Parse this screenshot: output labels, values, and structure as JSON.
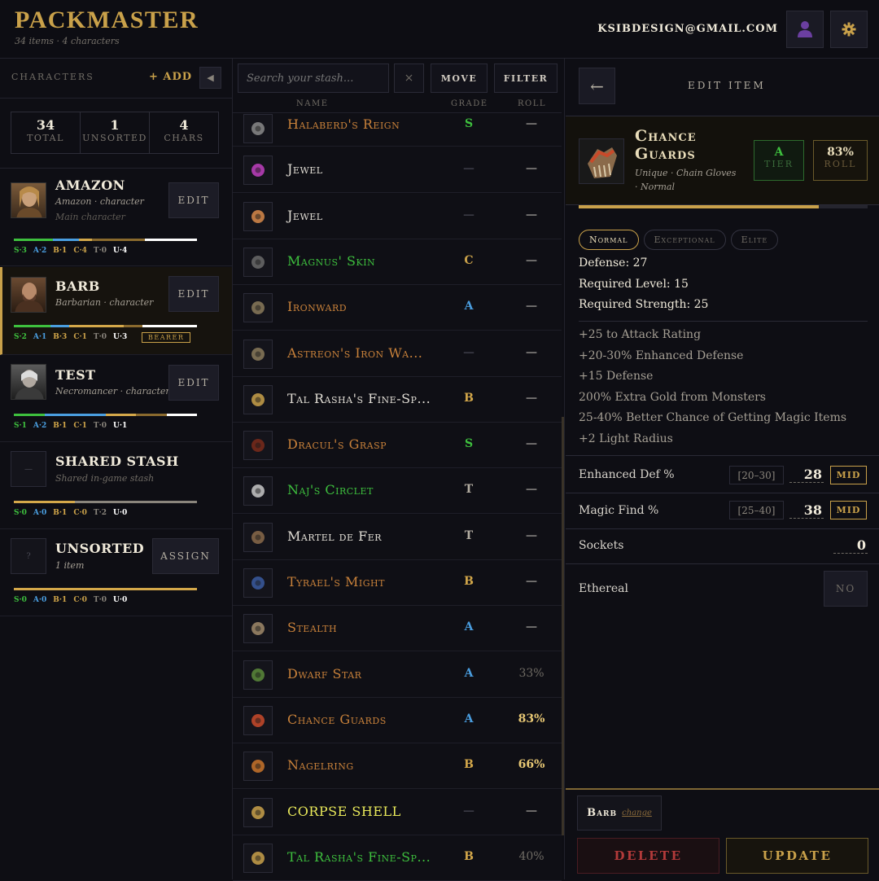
{
  "app": {
    "title": "PACKMASTER",
    "subtitle": "34 items · 4 characters",
    "email": "KSIBDESIGN@GMAIL.COM"
  },
  "colors": {
    "accent": "#c9a14a",
    "unique": "#c8813a",
    "set": "#3ec03e",
    "normal": "#e0dcd4",
    "rare": "#e8e85a",
    "danger": "#b23a3a",
    "grade_s": "#3ec03e",
    "grade_a": "#4a9ee0",
    "grade_b": "#d4a84a",
    "grade_c": "#c9a14a"
  },
  "icons": {
    "user": "user-icon",
    "settings": "gear-icon",
    "collapse": "chevron-left-icon",
    "back": "arrow-left-icon",
    "clear": "close-icon"
  },
  "sidebar": {
    "heading": "CHARACTERS",
    "add_label": "+ ADD",
    "collapse_label": "◀",
    "stats": [
      {
        "n": "34",
        "l": "TOTAL"
      },
      {
        "n": "1",
        "l": "UNSORTED"
      },
      {
        "n": "4",
        "l": "CHARS"
      }
    ],
    "characters": [
      {
        "name": "AMAZON",
        "sub": "Amazon · character",
        "note": "Main character",
        "btn": "EDIT",
        "grades": [
          [
            "S·3",
            "#3ec03e"
          ],
          [
            "A·2",
            "#4a9ee0"
          ],
          [
            "B·1",
            "#d4a84a"
          ],
          [
            "C·4",
            "#c9a14a"
          ],
          [
            "T·0",
            "#8a857c"
          ],
          [
            "U·4",
            "#ffffff"
          ]
        ]
      },
      {
        "name": "BARB",
        "sub": "Barbarian · character",
        "note": "",
        "btn": "EDIT",
        "bearer": "BEARER",
        "grades": [
          [
            "S·2",
            "#3ec03e"
          ],
          [
            "A·1",
            "#4a9ee0"
          ],
          [
            "B·3",
            "#d4a84a"
          ],
          [
            "C·1",
            "#c9a14a"
          ],
          [
            "T·0",
            "#8a857c"
          ],
          [
            "U·3",
            "#ffffff"
          ]
        ]
      },
      {
        "name": "TEST",
        "sub": "Necromancer · character",
        "note": "",
        "btn": "EDIT",
        "grades": [
          [
            "S·1",
            "#3ec03e"
          ],
          [
            "A·2",
            "#4a9ee0"
          ],
          [
            "B·1",
            "#d4a84a"
          ],
          [
            "C·1",
            "#c9a14a"
          ],
          [
            "T·0",
            "#8a857c"
          ],
          [
            "U·1",
            "#ffffff"
          ]
        ]
      },
      {
        "name": "SHARED STASH",
        "sub": "Shared in-game stash",
        "note": "",
        "btn": "",
        "portrait_text": "—",
        "grades": [
          [
            "S·0",
            "#3ec03e"
          ],
          [
            "A·0",
            "#4a9ee0"
          ],
          [
            "B·1",
            "#d4a84a"
          ],
          [
            "C·0",
            "#c9a14a"
          ],
          [
            "T·2",
            "#8a857c"
          ],
          [
            "U·0",
            "#ffffff"
          ]
        ]
      },
      {
        "name": "UNSORTED",
        "sub": "1 item",
        "note": "",
        "btn": "ASSIGN",
        "portrait_text": "?",
        "grades": [
          [
            "S·0",
            "#3ec03e"
          ],
          [
            "A·0",
            "#4a9ee0"
          ],
          [
            "B·1",
            "#d4a84a"
          ],
          [
            "C·0",
            "#c9a14a"
          ],
          [
            "T·0",
            "#8a857c"
          ],
          [
            "U·0",
            "#ffffff"
          ]
        ]
      }
    ]
  },
  "toolbar": {
    "search_placeholder": "Search your stash...",
    "clear": "×",
    "move": "MOVE",
    "filter": "FILTER"
  },
  "columns": {
    "name": "NAME",
    "grade": "GRADE",
    "roll": "ROLL"
  },
  "items": [
    {
      "name": "Halaberd's Reign",
      "color": "#c8813a",
      "grade": "S",
      "gcolor": "#3ec03e",
      "roll": "—",
      "rcolor": "#d8d4cc"
    },
    {
      "name": "Jewel",
      "color": "#e0dcd4",
      "grade": "—",
      "gcolor": "#3a3a44",
      "roll": "—",
      "rcolor": "#d8d4cc"
    },
    {
      "name": "Jewel",
      "color": "#e0dcd4",
      "grade": "—",
      "gcolor": "#3a3a44",
      "roll": "—",
      "rcolor": "#d8d4cc"
    },
    {
      "name": "Magnus' Skin",
      "color": "#3ec03e",
      "grade": "C",
      "gcolor": "#c9a14a",
      "roll": "—",
      "rcolor": "#d8d4cc"
    },
    {
      "name": "Ironward",
      "color": "#c8813a",
      "grade": "A",
      "gcolor": "#4a9ee0",
      "roll": "—",
      "rcolor": "#d8d4cc"
    },
    {
      "name": "Astreon's Iron Wa...",
      "color": "#c8813a",
      "grade": "—",
      "gcolor": "#3a3a44",
      "roll": "—",
      "rcolor": "#d8d4cc"
    },
    {
      "name": "Tal Rasha's Fine-Sp...",
      "color": "#e0dcd4",
      "grade": "B",
      "gcolor": "#d4a84a",
      "roll": "—",
      "rcolor": "#d8d4cc"
    },
    {
      "name": "Dracul's Grasp",
      "color": "#c8813a",
      "grade": "S",
      "gcolor": "#3ec03e",
      "roll": "—",
      "rcolor": "#d8d4cc"
    },
    {
      "name": "Naj's Circlet",
      "color": "#3ec03e",
      "grade": "T",
      "gcolor": "#b4aea2",
      "roll": "—",
      "rcolor": "#d8d4cc"
    },
    {
      "name": "Martel de Fer",
      "color": "#e0dcd4",
      "grade": "T",
      "gcolor": "#b4aea2",
      "roll": "—",
      "rcolor": "#d8d4cc"
    },
    {
      "name": "Tyrael's Might",
      "color": "#c8813a",
      "grade": "B",
      "gcolor": "#d4a84a",
      "roll": "—",
      "rcolor": "#d8d4cc"
    },
    {
      "name": "Stealth",
      "color": "#c8813a",
      "grade": "A",
      "gcolor": "#4a9ee0",
      "roll": "—",
      "rcolor": "#d8d4cc"
    },
    {
      "name": "Dwarf Star",
      "color": "#c8813a",
      "grade": "A",
      "gcolor": "#4a9ee0",
      "roll": "33%",
      "rcolor": "#6f6b64"
    },
    {
      "name": "Chance Guards",
      "color": "#c8813a",
      "grade": "A",
      "gcolor": "#4a9ee0",
      "roll": "83%",
      "rcolor": "#e8c874"
    },
    {
      "name": "Nagelring",
      "color": "#c8813a",
      "grade": "B",
      "gcolor": "#d4a84a",
      "roll": "66%",
      "rcolor": "#e8c874"
    },
    {
      "name": "CORPSE SHELL",
      "color": "#e8e85a",
      "grade": "—",
      "gcolor": "#3a3a44",
      "roll": "—",
      "rcolor": "#d8d4cc"
    },
    {
      "name": "Tal Rasha's Fine-Sp...",
      "color": "#3ec03e",
      "grade": "B",
      "gcolor": "#d4a84a",
      "roll": "40%",
      "rcolor": "#6f6b64"
    }
  ],
  "edit": {
    "back": "←",
    "title": "EDIT ITEM",
    "name": "Chance Guards",
    "type": "Unique · Chain Gloves · Normal",
    "tier": "A",
    "tier_label": "TIER",
    "roll": "83%",
    "roll_label": "ROLL",
    "roll_fraction": 0.83,
    "pills": [
      "Normal",
      "Exceptional",
      "Elite"
    ],
    "props": [
      "Defense: 27",
      "Required Level: 15",
      "Required Strength: 25"
    ],
    "mods": [
      "+25 to Attack Rating",
      "+20-30% Enhanced Defense",
      "+15 Defense",
      "200% Extra Gold from Monsters",
      "25-40% Better Chance of Getting Magic Items",
      "+2 Light Radius"
    ],
    "fields": [
      {
        "label": "Enhanced Def %",
        "range": "[20–30]",
        "value": "28",
        "tag": "MID"
      },
      {
        "label": "Magic Find %",
        "range": "[25–40]",
        "value": "38",
        "tag": "MID"
      }
    ],
    "sockets_label": "Sockets",
    "sockets_value": "0",
    "ethereal_label": "Ethereal",
    "ethereal_value": "NO",
    "owner": "Barb",
    "owner_change": "change",
    "delete": "DELETE",
    "update": "UPDATE"
  }
}
